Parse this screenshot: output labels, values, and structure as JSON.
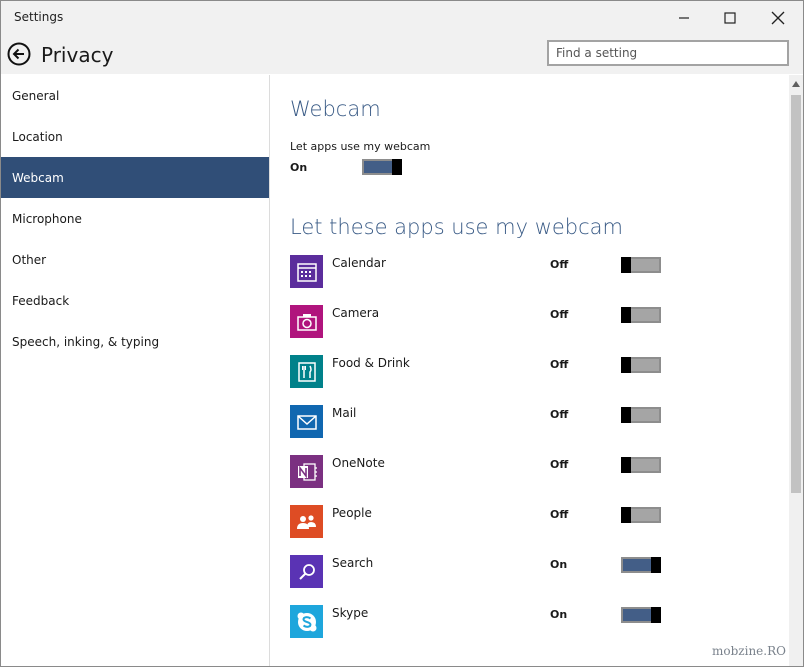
{
  "window": {
    "title": "Settings"
  },
  "header": {
    "title": "Privacy",
    "search_placeholder": "Find a setting"
  },
  "sidebar": {
    "items": [
      {
        "label": "General",
        "selected": false
      },
      {
        "label": "Location",
        "selected": false
      },
      {
        "label": "Webcam",
        "selected": true
      },
      {
        "label": "Microphone",
        "selected": false
      },
      {
        "label": "Other",
        "selected": false
      },
      {
        "label": "Feedback",
        "selected": false
      },
      {
        "label": "Speech, inking, & typing",
        "selected": false
      }
    ]
  },
  "main": {
    "title": "Webcam",
    "master": {
      "label": "Let apps use my webcam",
      "state": "On",
      "on": true
    },
    "apps_heading": "Let these apps use my webcam",
    "apps": [
      {
        "name": "Calendar",
        "state": "Off",
        "on": false,
        "icon": "calendar-icon",
        "color": "#5b2d9c"
      },
      {
        "name": "Camera",
        "state": "Off",
        "on": false,
        "icon": "camera-icon",
        "color": "#b0147d"
      },
      {
        "name": "Food & Drink",
        "state": "Off",
        "on": false,
        "icon": "food-drink-icon",
        "color": "#00818a"
      },
      {
        "name": "Mail",
        "state": "Off",
        "on": false,
        "icon": "mail-icon",
        "color": "#1067b0"
      },
      {
        "name": "OneNote",
        "state": "Off",
        "on": false,
        "icon": "onenote-icon",
        "color": "#7b3081"
      },
      {
        "name": "People",
        "state": "Off",
        "on": false,
        "icon": "people-icon",
        "color": "#de4c24"
      },
      {
        "name": "Search",
        "state": "On",
        "on": true,
        "icon": "search-icon",
        "color": "#5a33b4"
      },
      {
        "name": "Skype",
        "state": "On",
        "on": true,
        "icon": "skype-icon",
        "color": "#1ea6dc"
      }
    ]
  },
  "watermark": "mobzine.RO",
  "colors": {
    "accent": "#304e77",
    "toggle_on": "#435e87",
    "toggle_off": "#a5a5a5",
    "heading": "#3a5b86"
  }
}
